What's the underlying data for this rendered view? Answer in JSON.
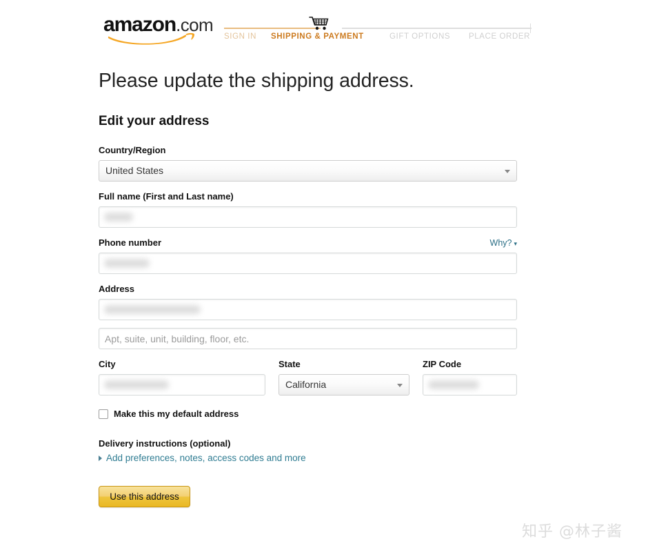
{
  "header": {
    "logo_word": "amazon",
    "logo_suffix": ".com",
    "logo_icon": "amazon-smile-swoosh",
    "cart_icon": "shopping-cart-icon",
    "steps": [
      {
        "label": "SIGN IN",
        "state": "completed"
      },
      {
        "label": "SHIPPING & PAYMENT",
        "state": "current"
      },
      {
        "label": "GIFT OPTIONS",
        "state": "upcoming"
      },
      {
        "label": "PLACE ORDER",
        "state": "upcoming"
      }
    ]
  },
  "main": {
    "page_title": "Please update the shipping address.",
    "section_title": "Edit your address"
  },
  "form": {
    "country": {
      "label": "Country/Region",
      "value": "United States",
      "caret_icon": "chevron-down-icon"
    },
    "full_name": {
      "label": "Full name (First and Last name)",
      "value": "",
      "placeholder": "",
      "redacted": true
    },
    "phone": {
      "label": "Phone number",
      "why_label": "Why?",
      "why_caret_icon": "chevron-down-icon",
      "value": "",
      "placeholder": "",
      "redacted": true
    },
    "address": {
      "label": "Address",
      "line1_value": "",
      "line1_placeholder": "",
      "line1_redacted": true,
      "line2_value": "",
      "line2_placeholder": "Apt, suite, unit, building, floor, etc."
    },
    "city": {
      "label": "City",
      "value": "",
      "placeholder": "",
      "redacted": true
    },
    "state": {
      "label": "State",
      "value": "California",
      "caret_icon": "chevron-down-icon"
    },
    "zip": {
      "label": "ZIP Code",
      "value": "",
      "placeholder": "",
      "redacted": true
    },
    "default_address": {
      "label": "Make this my default address",
      "checked": false
    },
    "delivery_instructions": {
      "label": "Delivery instructions (optional)",
      "expander_label": "Add preferences, notes, access codes and more",
      "expander_icon": "triangle-right-icon",
      "expanded": false
    },
    "submit": {
      "label": "Use this address"
    }
  },
  "watermark": {
    "text": "知乎 @林子酱"
  },
  "colors": {
    "brand_orange": "#cc7a1e",
    "progress_done": "#e8bb7f",
    "progress_todo": "#dddddd",
    "link_teal": "#2f7c92",
    "button_gold": "#eec53f"
  }
}
